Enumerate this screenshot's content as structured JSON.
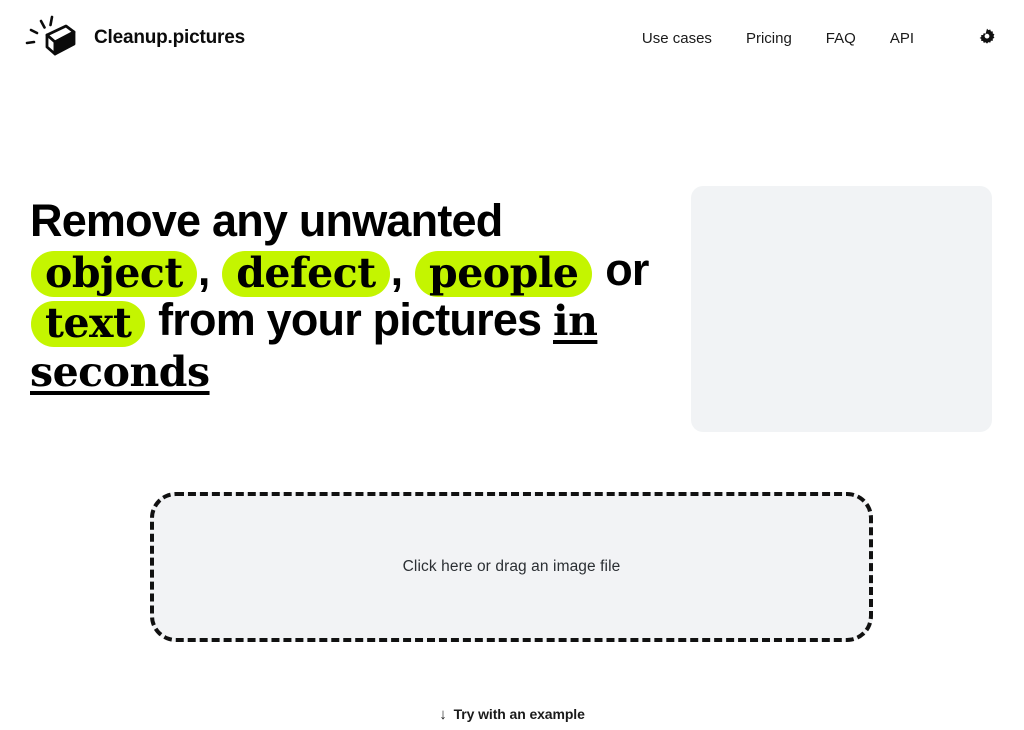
{
  "brand": {
    "name": "Cleanup.pictures",
    "logo_icon": "eraser-sparkle-icon"
  },
  "nav": {
    "links": [
      {
        "label": "Use cases"
      },
      {
        "label": "Pricing"
      },
      {
        "label": "FAQ"
      },
      {
        "label": "API"
      }
    ],
    "settings_icon": "gear-icon"
  },
  "hero": {
    "line1_part1": "Remove any unwanted",
    "highlight1": "object",
    "comma1": ",",
    "highlight2": "defect",
    "comma2": ",",
    "highlight3": "people",
    "or_word": "or",
    "highlight4": "text",
    "line3_part": "from your pictures",
    "underlined1": "in",
    "underlined2": "seconds",
    "highlight_color": "#c4f500",
    "media_placeholder": ""
  },
  "dropzone": {
    "label": "Click here or drag an image file"
  },
  "example": {
    "arrow": "↓",
    "label": "Try with an example"
  }
}
